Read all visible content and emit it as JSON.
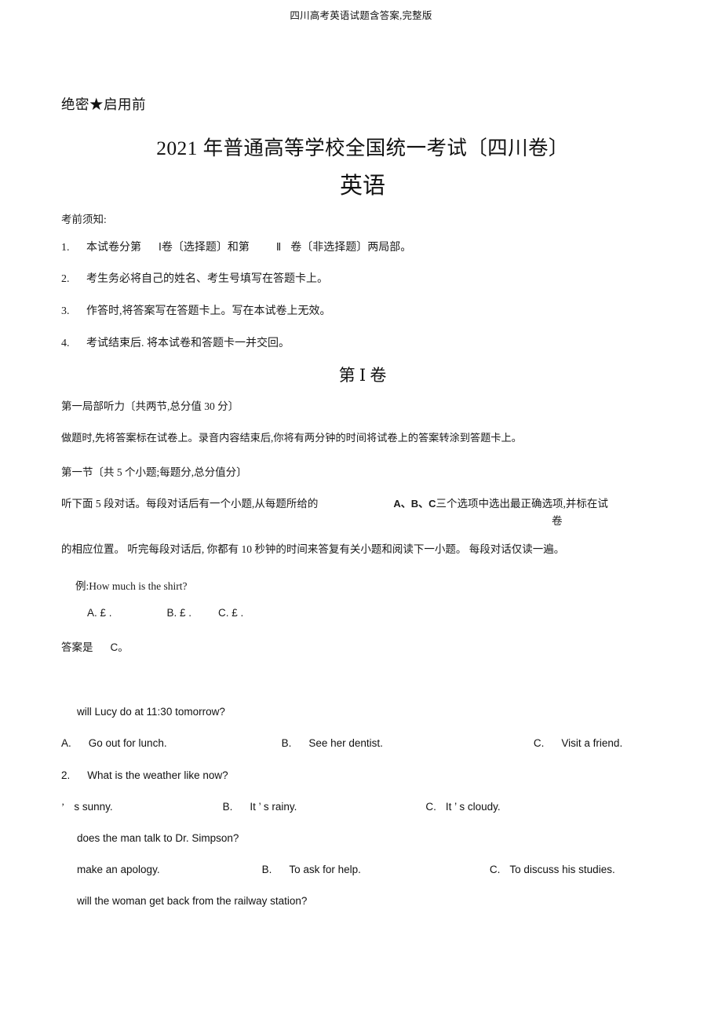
{
  "document": {
    "running_header": "四川高考英语试题含答案,完整版",
    "secret_line": "绝密★启用前",
    "main_title": "2021 年普通高等学校全国统一考试〔四川卷〕",
    "subject_title": "英语",
    "notes_label": "考前须知:",
    "notes": [
      {
        "num": "1.",
        "text_before": "本试卷分第",
        "roman_1": "Ⅰ",
        "text_mid": "卷〔选择题〕和第",
        "roman_2": "Ⅱ",
        "text_after": "卷〔非选择题〕两局部。"
      },
      {
        "num": "2.",
        "text": "考生务必将自己的姓名、考生号填写在答题卡上。"
      },
      {
        "num": "3.",
        "text": "作答时,将答案写在答题卡上。写在本试卷上无效。"
      },
      {
        "num": "4.",
        "text": "考试结束后. 将本试卷和答题卡一并交回。"
      }
    ],
    "paper_part_label": "第 Ⅰ 卷",
    "section_one_heading": "第一局部听力〔共两节,总分值   30 分〕",
    "do_instruction": "做题时,先将答案标在试卷上。录音内容结束后,你将有两分钟的时间将试卷上的答案转涂到答题卡上。",
    "part_one_heading": "第一节〔共  5 个小题;每题分,总分值分〕",
    "listen_instruction_a_before": "听下面  5 段对话。每段对话后有一个小题,从每题所给的",
    "listen_instruction_a_abc": "A、B、C",
    "listen_instruction_a_after": "三个选项中选出最正确选项,并标在试",
    "listen_instruction_a_wrap": "卷",
    "listen_instruction_b": "的相应位置。  听完每段对话后,   你都有  10 秒钟的时间来答复有关小题和阅读下一小题。         每段对话仅读一遍。",
    "example_stem": "例:How  much   is    the    shirt?",
    "example_options": {
      "a": "A. £ .",
      "b": "B. £ .",
      "c": "C. £ ."
    },
    "answer_label": "答案是",
    "answer_value": "C。"
  },
  "questions": [
    {
      "id": "q1",
      "stem": "will    Lucy   do   at    11:30   tomorrow?",
      "options": {
        "a_label": "A.",
        "a_text": "Go  out   for    lunch.",
        "b_label": "B.",
        "b_text": "See  her   dentist.",
        "c_label": "C.",
        "c_text": "Visit    a   friend."
      }
    },
    {
      "id": "q2",
      "number": "2.",
      "stem": "What is    the    weather   like    now?",
      "options": {
        "a_text": "s sunny.",
        "b_label": "B.",
        "b_text": "It ’ s rainy.",
        "c_label": "C.",
        "c_text": "It  ’ s cloudy."
      }
    },
    {
      "id": "q3",
      "stem": "does   the   man  talk   to   Dr.   Simpson?",
      "options": {
        "a_text": "make  an  apology.",
        "b_label": "B.",
        "b_text": "To   ask   for    help.",
        "c_label": "C.",
        "c_text": "To   discuss    his  studies."
      }
    },
    {
      "id": "q4",
      "stem": "will    the    woman get   back from    the   railway    station?"
    }
  ]
}
